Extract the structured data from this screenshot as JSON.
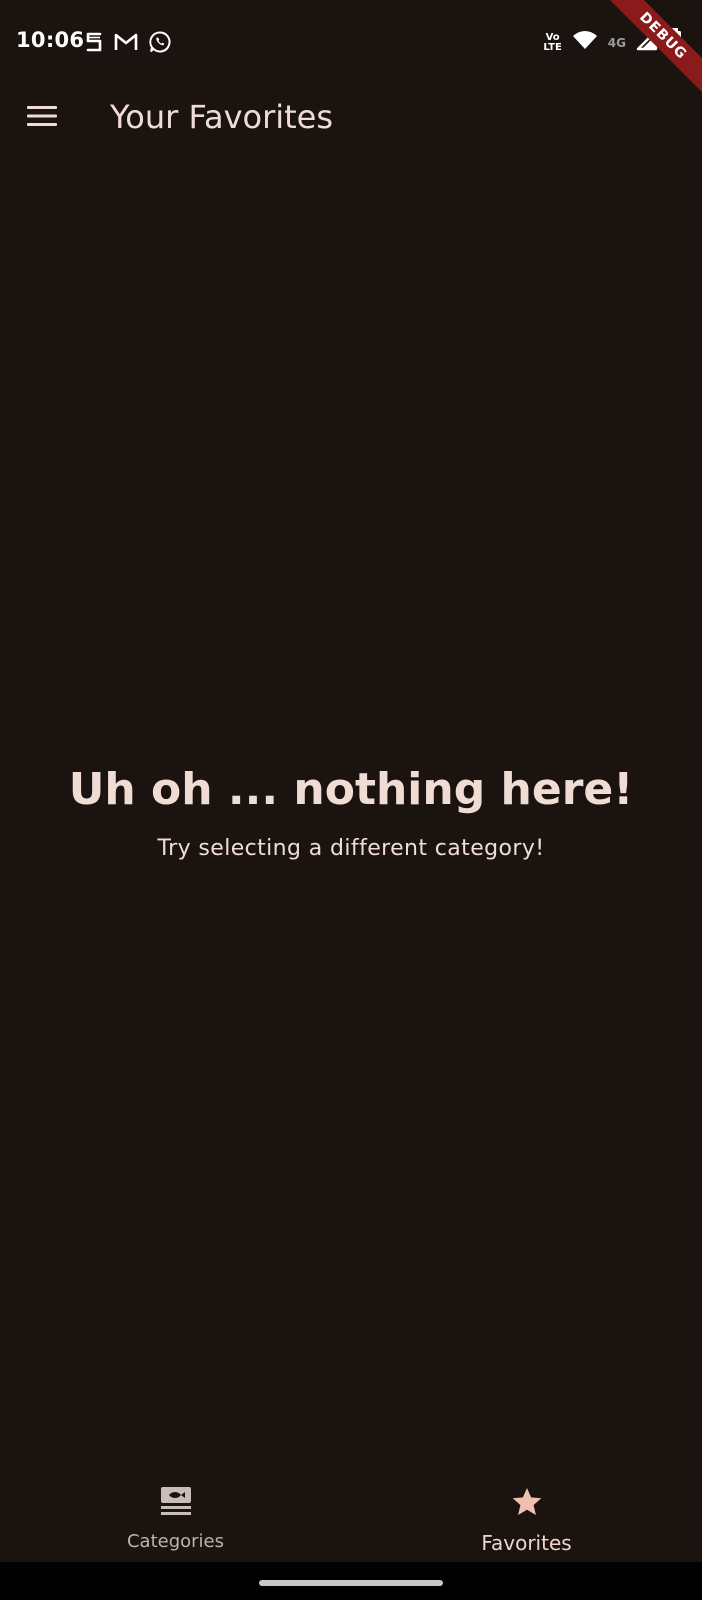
{
  "status_bar": {
    "time": "10:06",
    "left_icons": [
      "notification-s-icon",
      "gmail-icon",
      "whatsapp-icon"
    ],
    "right_icons": [
      "volte-icon",
      "wifi-icon",
      "signal-icon",
      "battery-icon"
    ],
    "volte_top": "Vo",
    "volte_bottom": "LTE",
    "network_label": "4G",
    "roaming_label": "R"
  },
  "debug_banner": "DEBUG",
  "app_bar": {
    "title": "Your Favorites"
  },
  "empty_state": {
    "title": "Uh oh ... nothing here!",
    "subtitle": "Try selecting a different category!"
  },
  "bottom_nav": {
    "items": [
      {
        "label": "Categories",
        "icon": "set-meal-icon",
        "active": false
      },
      {
        "label": "Favorites",
        "icon": "star-icon",
        "active": true
      }
    ]
  },
  "colors": {
    "background": "#1b1310",
    "on_surface": "#efdcd5",
    "active_accent": "#f0c0ae",
    "inactive_icon": "#c9bdb8",
    "debug_ribbon": "#8b1b1b"
  }
}
